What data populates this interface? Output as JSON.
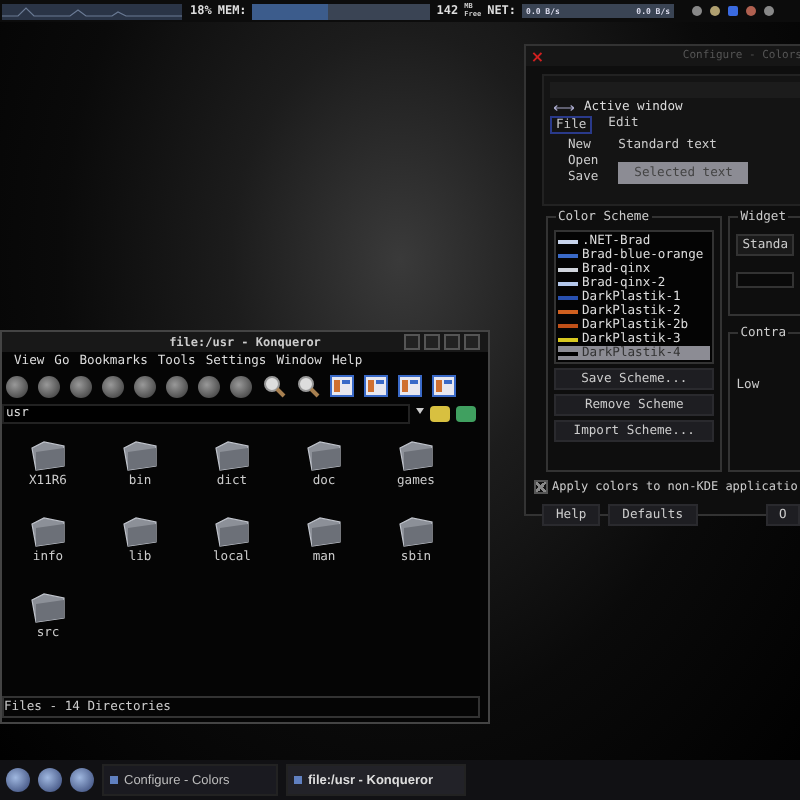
{
  "top_panel": {
    "cpu_reading": "18%",
    "memory": {
      "label": "MEM:",
      "level": 0.42,
      "reading": "142",
      "unit_top": "MB",
      "unit_bottom": "Free"
    },
    "network": {
      "label": "NET:",
      "in_reading": "0.0 B/s",
      "out_reading": "0.0 B/s"
    }
  },
  "configure_window": {
    "title": "Configure - Colors",
    "preview": {
      "active_title": "Active window",
      "menu": [
        "File",
        "Edit"
      ],
      "menu_items": [
        "New",
        "Open",
        "Save"
      ],
      "standard_text": "Standard text",
      "selected_text": "Selected text"
    },
    "scheme_group": {
      "title": "Color Scheme",
      "schemes": [
        {
          "name": ".NET-Brad",
          "color": "#c8d4ec",
          "selected": false
        },
        {
          "name": "Brad-blue-orange",
          "color": "#3a6ac8",
          "selected": false
        },
        {
          "name": "Brad-qinx",
          "color": "#d0d4dc",
          "selected": false
        },
        {
          "name": "Brad-qinx-2",
          "color": "#b4c8ec",
          "selected": false
        },
        {
          "name": "DarkPlastik-1",
          "color": "#2850b0",
          "selected": false
        },
        {
          "name": "DarkPlastik-2",
          "color": "#d06020",
          "selected": false
        },
        {
          "name": "DarkPlastik-2b",
          "color": "#c05018",
          "selected": false
        },
        {
          "name": "DarkPlastik-3",
          "color": "#d8c820",
          "selected": false
        },
        {
          "name": "DarkPlastik-4",
          "color": "#000000",
          "selected": true
        }
      ],
      "buttons": [
        "Save Scheme...",
        "Remove Scheme",
        "Import Scheme..."
      ]
    },
    "widget_group": {
      "title": "Widget",
      "combo": "Standa"
    },
    "contrast_group": {
      "title": "Contra",
      "low_label": "Low"
    },
    "apply_non_kde": {
      "label": "Apply colors to non-KDE applicatio",
      "checked": true
    },
    "footer_buttons": [
      "Help",
      "Defaults",
      "O"
    ]
  },
  "konqueror_window": {
    "title": "file:/usr - Konqueror",
    "menu": [
      "View",
      "Go",
      "Bookmarks",
      "Tools",
      "Settings",
      "Window",
      "Help"
    ],
    "location": "usr",
    "files": [
      "X11R6",
      "bin",
      "dict",
      "doc",
      "games",
      "info",
      "lib",
      "local",
      "man",
      "sbin",
      "src"
    ],
    "status": "Files - 14 Directories"
  },
  "taskbar": {
    "tasks": [
      {
        "label": "Configure - Colors",
        "selected": false
      },
      {
        "label": "file:/usr - Konqueror",
        "selected": true
      }
    ]
  }
}
